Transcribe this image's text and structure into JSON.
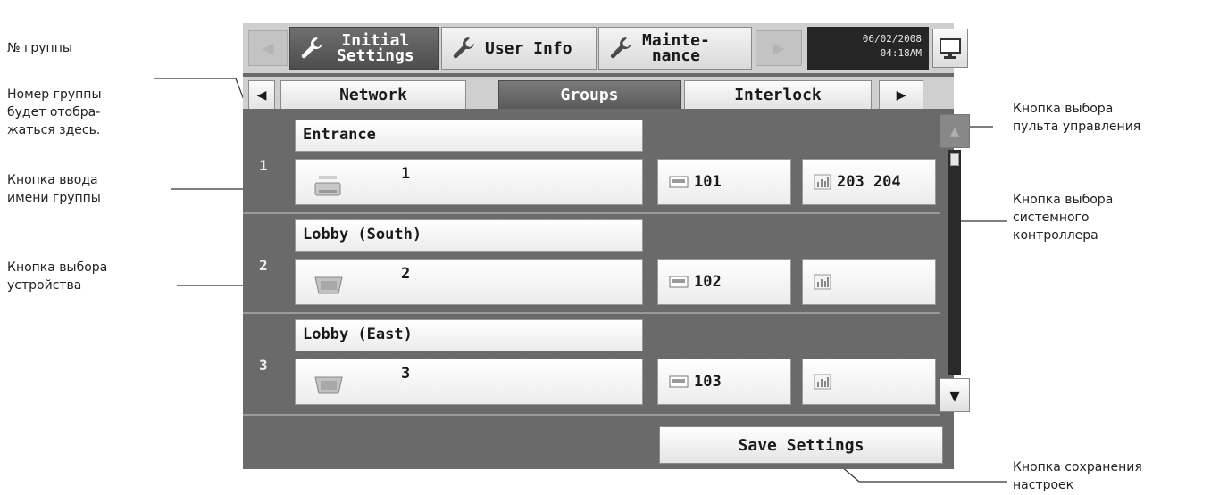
{
  "annotations": {
    "group_no": "№ группы",
    "group_number_note": "Номер группы\nбудет отобра-\nжаться здесь.",
    "group_name_button": "Кнопка ввода\nимени группы",
    "unit_select_button": "Кнопка выбора\nустройства",
    "remote_select_button": "Кнопка выбора\nпульта управления",
    "system_controller_button": "Кнопка выбора\nсистемного\nконтроллера",
    "save_settings_button": "Кнопка сохранения\nнастроек"
  },
  "topbar": {
    "tabs": [
      {
        "label": "Initial\nSettings",
        "active": true,
        "icon": "wrench-icon"
      },
      {
        "label": "User Info",
        "active": false,
        "icon": "wrench-icon"
      },
      {
        "label": "Mainte-\nnance",
        "active": false,
        "icon": "wrench-icon"
      }
    ],
    "date": "06/02/2008",
    "time": "04:18AM",
    "monitor_icon": "monitor-icon"
  },
  "subtabs": [
    {
      "label": "Network",
      "active": false
    },
    {
      "label": "Groups",
      "active": true
    },
    {
      "label": "Interlock",
      "active": false
    }
  ],
  "groups": [
    {
      "number": "1",
      "name": "Entrance",
      "unit": "1",
      "remote": "101",
      "controllers": "203 204"
    },
    {
      "number": "2",
      "name": "Lobby (South)",
      "unit": "2",
      "remote": "102",
      "controllers": ""
    },
    {
      "number": "3",
      "name": "Lobby (East)",
      "unit": "3",
      "remote": "103",
      "controllers": ""
    }
  ],
  "save_label": "Save Settings",
  "colors": {
    "active_tab": "#5a5a5a",
    "panel": "#6a6a6a",
    "bar": "#cfcfcf"
  }
}
